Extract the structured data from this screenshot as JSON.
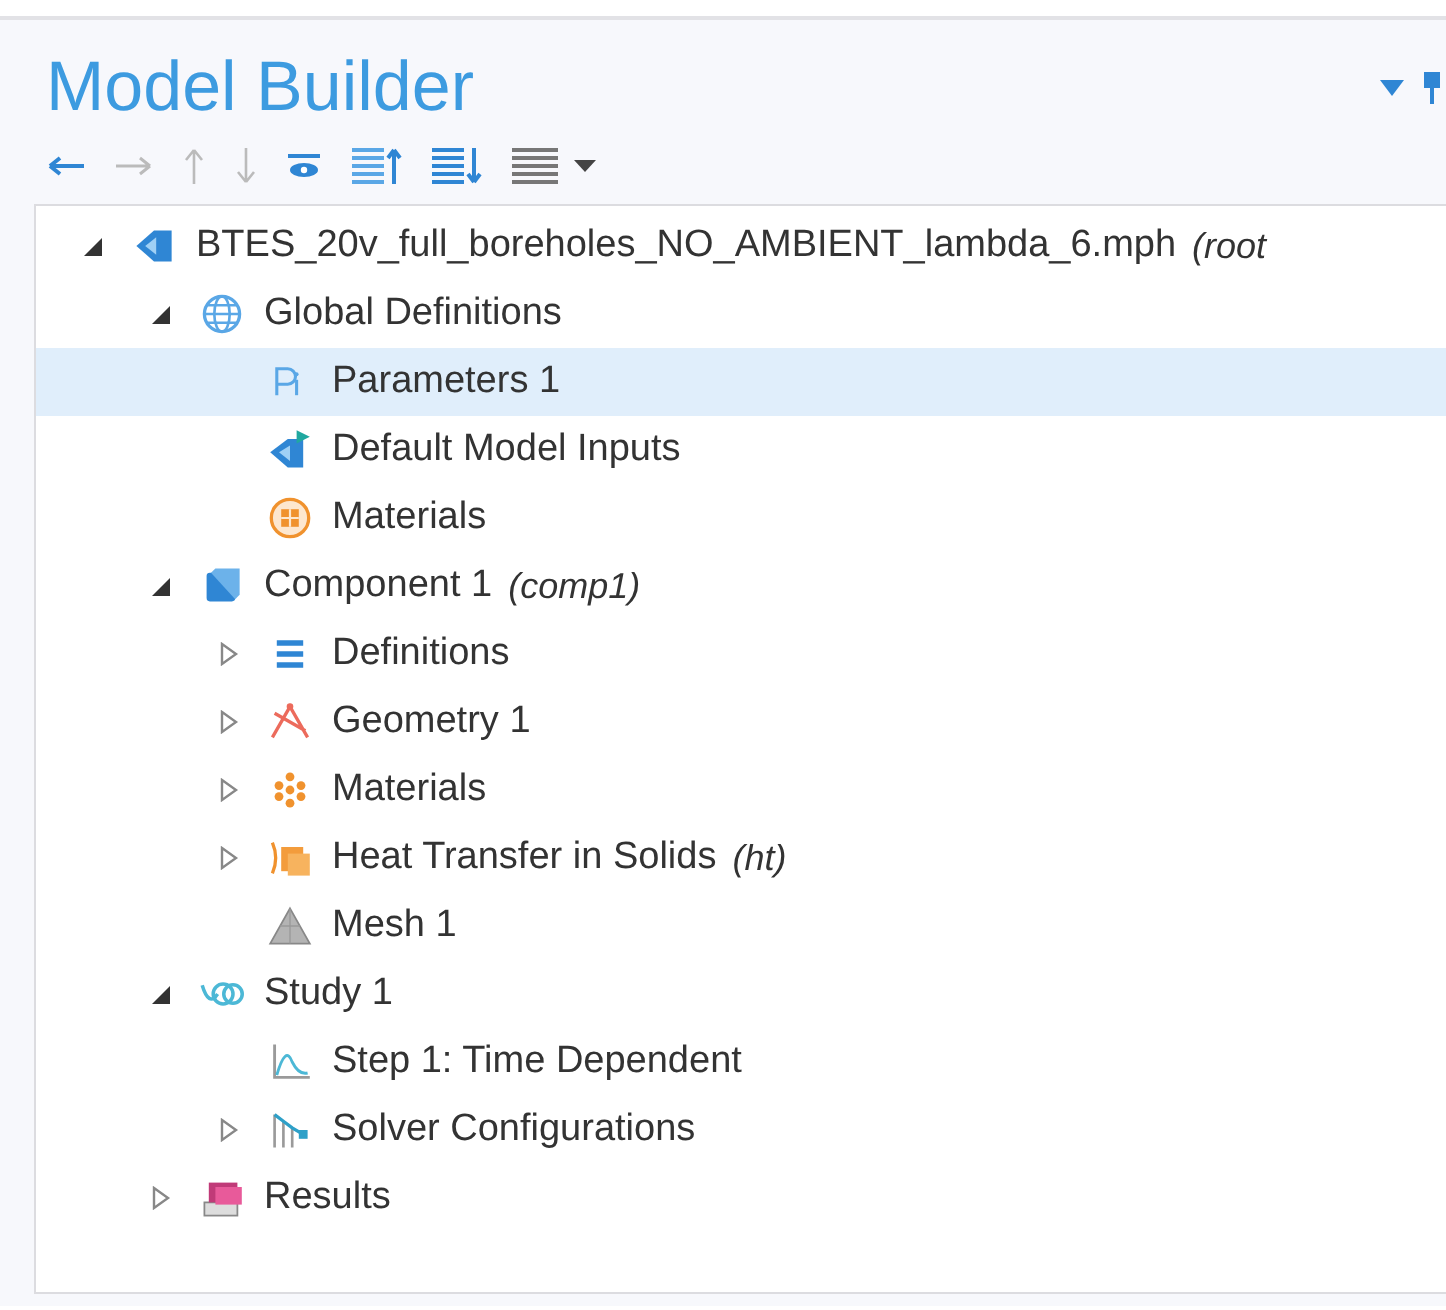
{
  "panel": {
    "title": "Model Builder"
  },
  "tree": [
    {
      "label": "BTES_20v_full_boreholes_NO_AMBIENT_lambda_6.mph",
      "suffix": "(root",
      "kind": "model",
      "expanded": true,
      "selected": false,
      "children": [
        {
          "label": "Global Definitions",
          "kind": "globe",
          "expanded": true,
          "selected": false,
          "children": [
            {
              "label": "Parameters 1",
              "kind": "parameters",
              "selected": true
            },
            {
              "label": "Default Model Inputs",
              "kind": "inputs",
              "selected": false
            },
            {
              "label": "Materials",
              "kind": "materials-circle",
              "selected": false
            }
          ]
        },
        {
          "label": "Component 1",
          "suffix": "(comp1)",
          "kind": "component",
          "expanded": true,
          "selected": false,
          "children": [
            {
              "label": "Definitions",
              "kind": "definitions",
              "expanded": false,
              "selected": false
            },
            {
              "label": "Geometry 1",
              "kind": "geometry",
              "expanded": false,
              "selected": false
            },
            {
              "label": "Materials",
              "kind": "materials",
              "expanded": false,
              "selected": false
            },
            {
              "label": "Heat Transfer in Solids",
              "suffix": "(ht)",
              "kind": "physics",
              "expanded": false,
              "selected": false
            },
            {
              "label": "Mesh 1",
              "kind": "mesh",
              "selected": false
            }
          ]
        },
        {
          "label": "Study 1",
          "kind": "study",
          "expanded": true,
          "selected": false,
          "children": [
            {
              "label": "Step 1: Time Dependent",
              "kind": "step",
              "selected": false
            },
            {
              "label": "Solver Configurations",
              "kind": "solver",
              "expanded": false,
              "selected": false
            }
          ]
        },
        {
          "label": "Results",
          "kind": "results",
          "expanded": false,
          "selected": false
        }
      ]
    }
  ]
}
